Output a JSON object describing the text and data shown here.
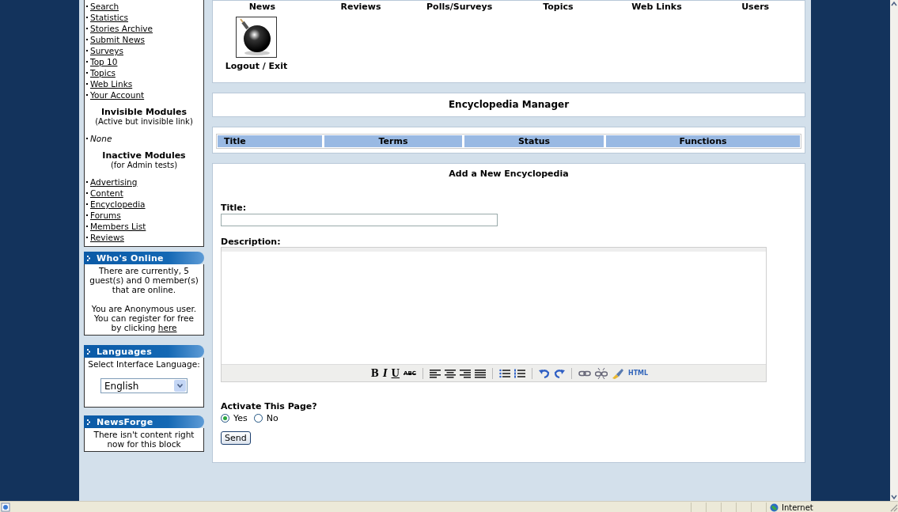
{
  "top_nav": {
    "links": [
      "News",
      "Reviews",
      "Polls/Surveys",
      "Topics",
      "Web Links",
      "Users"
    ],
    "logout": "Logout / Exit"
  },
  "sidebar": {
    "modules": {
      "active": [
        "Search",
        "Statistics",
        "Stories Archive",
        "Submit News",
        "Surveys",
        "Top 10",
        "Topics",
        "Web Links",
        "Your Account"
      ],
      "invisible_title": "Invisible Modules",
      "invisible_note": "(Active but invisible link)",
      "invisible": [
        "None"
      ],
      "inactive_title": "Inactive Modules",
      "inactive_note": "(for Admin tests)",
      "inactive": [
        "Advertising",
        "Content",
        "Encyclopedia",
        "Forums",
        "Members List",
        "Reviews"
      ]
    },
    "whos_online": {
      "title": "Who's Online",
      "text": "There are currently, 5 guest(s) and 0 member(s) that are online.",
      "text2": "You are Anonymous user. You can register for free by clicking",
      "link": "here"
    },
    "languages": {
      "title": "Languages",
      "label": "Select Interface Language:",
      "value": "English"
    },
    "newsforge": {
      "title": "NewsForge",
      "text": "There isn't content right now for this block"
    }
  },
  "manager": {
    "title": "Encyclopedia Manager",
    "columns": [
      "Title",
      "Terms",
      "Status",
      "Functions"
    ]
  },
  "add_form": {
    "title": "Add a New Encyclopedia",
    "title_label": "Title:",
    "description_label": "Description:",
    "format_buttons": [
      "B",
      "I",
      "U",
      "ABC"
    ],
    "html_button": "HTML",
    "activate": {
      "label": "Activate This Page?",
      "options": [
        {
          "label": "Yes",
          "selected": true
        },
        {
          "label": "No",
          "selected": false
        }
      ]
    },
    "submit": "Send"
  },
  "status_bar": {
    "zone": "Internet"
  }
}
